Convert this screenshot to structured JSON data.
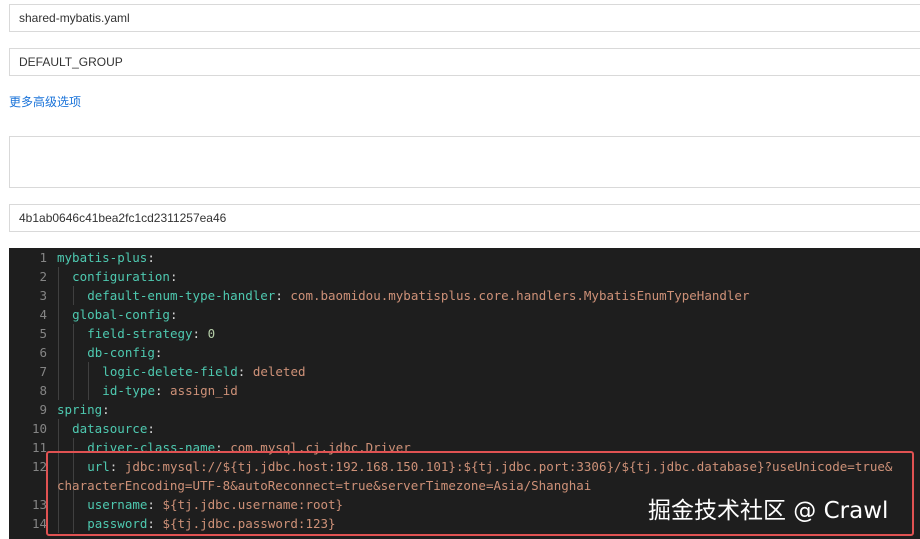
{
  "form": {
    "data_id": "shared-mybatis.yaml",
    "group": "DEFAULT_GROUP",
    "advanced_link": "更多高级选项",
    "description": "",
    "md5": "4b1ab0646c41bea2fc1cd2311257ea46"
  },
  "editor": {
    "lines": [
      {
        "num": "1",
        "indent": 0,
        "key": "mybatis-plus",
        "value": ""
      },
      {
        "num": "2",
        "indent": 1,
        "key": "configuration",
        "value": ""
      },
      {
        "num": "3",
        "indent": 2,
        "key": "default-enum-type-handler",
        "value": "com.baomidou.mybatisplus.core.handlers.MybatisEnumTypeHandler"
      },
      {
        "num": "4",
        "indent": 1,
        "key": "global-config",
        "value": ""
      },
      {
        "num": "5",
        "indent": 2,
        "key": "field-strategy",
        "value": "0"
      },
      {
        "num": "6",
        "indent": 2,
        "key": "db-config",
        "value": ""
      },
      {
        "num": "7",
        "indent": 3,
        "key": "logic-delete-field",
        "value": "deleted"
      },
      {
        "num": "8",
        "indent": 3,
        "key": "id-type",
        "value": "assign_id"
      },
      {
        "num": "9",
        "indent": 0,
        "key": "spring",
        "value": ""
      },
      {
        "num": "10",
        "indent": 1,
        "key": "datasource",
        "value": ""
      },
      {
        "num": "11",
        "indent": 2,
        "key": "driver-class-name",
        "value": "com.mysql.cj.jdbc.Driver"
      },
      {
        "num": "12",
        "indent": 2,
        "key": "url",
        "value": "jdbc:mysql://${tj.jdbc.host:192.168.150.101}:${tj.jdbc.port:3306}/${tj.jdbc.database}?useUnicode=true&"
      },
      {
        "num": "",
        "indent": 0,
        "key": "",
        "value": "characterEncoding=UTF-8&autoReconnect=true&serverTimezone=Asia/Shanghai"
      },
      {
        "num": "13",
        "indent": 2,
        "key": "username",
        "value": "${tj.jdbc.username:root}"
      },
      {
        "num": "14",
        "indent": 2,
        "key": "password",
        "value": "${tj.jdbc.password:123}"
      }
    ]
  },
  "watermark": "掘金技术社区 @ Crawl"
}
